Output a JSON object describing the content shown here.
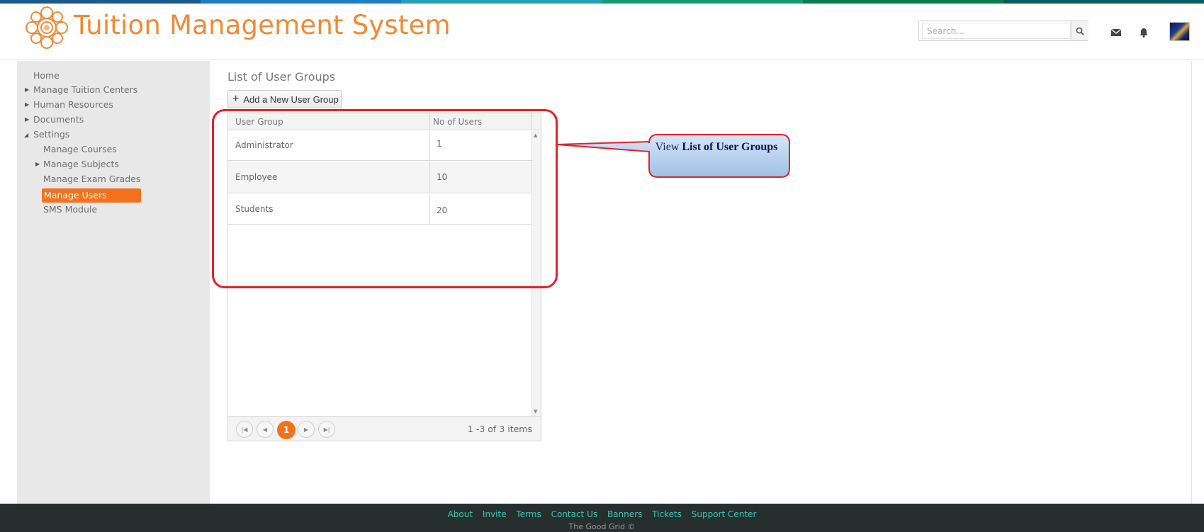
{
  "app": {
    "title": "Tuition Management System"
  },
  "colors": {
    "accent": "#f4721e",
    "title": "#f08a34",
    "highlight": "#e3212d",
    "footer_bg": "#262f2d",
    "footer_link": "#3cc6b0"
  },
  "top_stripe": [
    "#1a5a8c",
    "#1c7fc2",
    "#21a0b8",
    "#169b6e",
    "#0b7a4f",
    "#0a5e60"
  ],
  "header": {
    "search_placeholder": "Search...",
    "icons": [
      "search-icon",
      "envelope-icon",
      "bell-icon",
      "avatar"
    ]
  },
  "sidebar": {
    "items": [
      {
        "label": "Home"
      },
      {
        "label": "Manage Tuition Centers",
        "collapsed": true
      },
      {
        "label": "Human Resources",
        "collapsed": true
      },
      {
        "label": "Documents",
        "collapsed": true
      },
      {
        "label": "Settings",
        "expanded": true
      },
      {
        "label": "Manage Courses"
      },
      {
        "label": "Manage Subjects",
        "collapsed": true
      },
      {
        "label": "Manage Exam Grades"
      },
      {
        "label": "Manage Users",
        "active": true
      },
      {
        "label": "SMS Module"
      }
    ]
  },
  "main": {
    "title": "List of User Groups",
    "add_button": "Add a New User Group",
    "table": {
      "columns": [
        "User Group",
        "No of Users"
      ],
      "rows": [
        {
          "group": "Administrator",
          "users": "1"
        },
        {
          "group": "Employee",
          "users": "10"
        },
        {
          "group": "Students",
          "users": "20"
        }
      ]
    },
    "pager": {
      "current_page": "1",
      "info": "1 -3 of 3 items"
    }
  },
  "callout": {
    "prefix": "View",
    "bold": "List of User Groups"
  },
  "footer": {
    "links": [
      "About",
      "Invite",
      "Terms",
      "Contact Us",
      "Banners",
      "Tickets",
      "Support Center"
    ],
    "copyright": "The Good Grid ©"
  }
}
